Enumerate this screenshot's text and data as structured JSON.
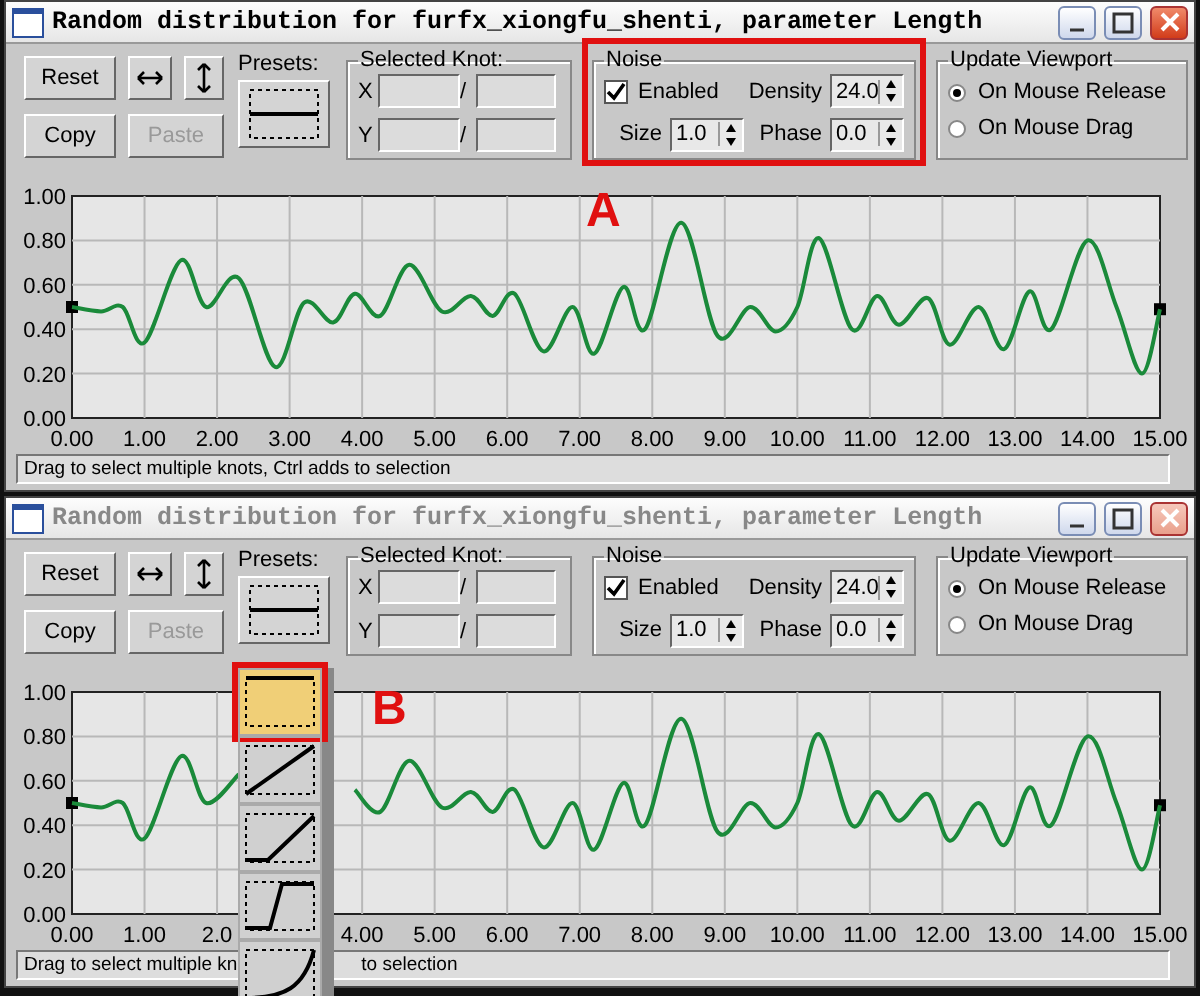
{
  "windows": [
    {
      "title": "Random distribution for furfx_xiongfu_shenti, parameter Length",
      "active": true,
      "toolbar": {
        "reset": "Reset",
        "copy": "Copy",
        "paste": {
          "label": "Paste",
          "disabled": true
        },
        "presets_label": "Presets:"
      },
      "selected_knot": {
        "title": "Selected Knot:",
        "rows": [
          {
            "label": "X",
            "separator": "/"
          },
          {
            "label": "Y",
            "separator": "/"
          }
        ]
      },
      "noise": {
        "title": "Noise",
        "enabled": {
          "label": "Enabled",
          "checked": true
        },
        "fields": [
          {
            "label": "Density",
            "value": "24.0"
          },
          {
            "label": "Size",
            "value": "1.0"
          },
          {
            "label": "Phase",
            "value": "0.0"
          }
        ],
        "annotation": {
          "label": "A"
        }
      },
      "update_viewport": {
        "title": "Update Viewport",
        "options": [
          {
            "label": "On Mouse Release",
            "selected": true
          },
          {
            "label": "On Mouse Drag",
            "selected": false
          }
        ]
      },
      "chart_data": {
        "type": "line",
        "xlim": [
          0,
          15
        ],
        "ylim": [
          0,
          1
        ],
        "yticks": [
          {
            "value": 1,
            "label": "1.00"
          },
          {
            "value": 0.8,
            "label": "0.80"
          },
          {
            "value": 0.6,
            "label": "0.60"
          },
          {
            "value": 0.4,
            "label": "0.40"
          },
          {
            "value": 0.2,
            "label": "0.20"
          },
          {
            "value": 0,
            "label": "0.00"
          }
        ],
        "xticks": [
          {
            "value": 0,
            "label": "0.00"
          },
          {
            "value": 1,
            "label": "1.00"
          },
          {
            "value": 2,
            "label": "2.00"
          },
          {
            "value": 3,
            "label": "3.00"
          },
          {
            "value": 4,
            "label": "4.00"
          },
          {
            "value": 5,
            "label": "5.00"
          },
          {
            "value": 6,
            "label": "6.00"
          },
          {
            "value": 7,
            "label": "7.00"
          },
          {
            "value": 8,
            "label": "8.00"
          },
          {
            "value": 9,
            "label": "9.00"
          },
          {
            "value": 10,
            "label": "10.00"
          },
          {
            "value": 11,
            "label": "11.00"
          },
          {
            "value": 12,
            "label": "12.00"
          },
          {
            "value": 13,
            "label": "13.00"
          },
          {
            "value": 14,
            "label": "14.00"
          },
          {
            "value": 15,
            "label": "15.00"
          }
        ],
        "x": [
          0,
          0.4,
          0.7,
          1,
          1.5,
          1.85,
          2.3,
          2.8,
          3.2,
          3.6,
          3.9,
          4.25,
          4.65,
          5.1,
          5.5,
          5.8,
          6.1,
          6.5,
          6.9,
          7.2,
          7.6,
          7.9,
          8.4,
          8.9,
          9.35,
          9.7,
          10,
          10.3,
          10.75,
          11.1,
          11.4,
          11.8,
          12.1,
          12.5,
          12.85,
          13.2,
          13.5,
          14,
          14.4,
          14.75,
          15
        ],
        "series": [
          {
            "color": "#1a8a3a",
            "values": [
              0.5,
              0.48,
              0.5,
              0.34,
              0.71,
              0.5,
              0.63,
              0.23,
              0.52,
              0.43,
              0.56,
              0.46,
              0.69,
              0.48,
              0.55,
              0.46,
              0.56,
              0.3,
              0.5,
              0.29,
              0.59,
              0.4,
              0.88,
              0.37,
              0.5,
              0.39,
              0.5,
              0.81,
              0.4,
              0.55,
              0.42,
              0.54,
              0.33,
              0.5,
              0.31,
              0.57,
              0.4,
              0.8,
              0.5,
              0.2,
              0.49
            ]
          }
        ],
        "grid": true
      },
      "status": [
        "Drag to select multiple knots, Ctrl adds to selection"
      ]
    },
    {
      "title": "Random distribution for furfx_xiongfu_shenti, parameter Length",
      "active": false,
      "toolbar": {
        "reset": "Reset",
        "copy": "Copy",
        "paste": {
          "label": "Paste",
          "disabled": true
        },
        "presets_label": "Presets:"
      },
      "selected_knot": {
        "title": "Selected Knot:",
        "rows": [
          {
            "label": "X",
            "separator": "/"
          },
          {
            "label": "Y",
            "separator": "/"
          }
        ]
      },
      "noise": {
        "title": "Noise",
        "enabled": {
          "label": "Enabled",
          "checked": true
        },
        "fields": [
          {
            "label": "Density",
            "value": "24.0"
          },
          {
            "label": "Size",
            "value": "1.0"
          },
          {
            "label": "Phase",
            "value": "0.0"
          }
        ]
      },
      "update_viewport": {
        "title": "Update Viewport",
        "options": [
          {
            "label": "On Mouse Release",
            "selected": true
          },
          {
            "label": "On Mouse Drag",
            "selected": false
          }
        ]
      },
      "chart_data": {
        "type": "line",
        "xlim": [
          0,
          15
        ],
        "ylim": [
          0,
          1
        ],
        "yticks": [
          {
            "value": 1,
            "label": "1.00"
          },
          {
            "value": 0.8,
            "label": "0.80"
          },
          {
            "value": 0.6,
            "label": "0.60"
          },
          {
            "value": 0.4,
            "label": "0.40"
          },
          {
            "value": 0.2,
            "label": "0.20"
          },
          {
            "value": 0,
            "label": "0.00"
          }
        ],
        "xticks": [
          {
            "value": 0,
            "label": "0.00"
          },
          {
            "value": 1,
            "label": "1.00"
          },
          {
            "value": 2,
            "label": "2.0"
          },
          {
            "value": 4,
            "label": "4.00"
          },
          {
            "value": 5,
            "label": "5.00"
          },
          {
            "value": 6,
            "label": "6.00"
          },
          {
            "value": 7,
            "label": "7.00"
          },
          {
            "value": 8,
            "label": "8.00"
          },
          {
            "value": 9,
            "label": "9.00"
          },
          {
            "value": 10,
            "label": "10.00"
          },
          {
            "value": 11,
            "label": "11.00"
          },
          {
            "value": 12,
            "label": "12.00"
          },
          {
            "value": 13,
            "label": "13.00"
          },
          {
            "value": 14,
            "label": "14.00"
          },
          {
            "value": 15,
            "label": "15.00"
          }
        ],
        "x": [
          0,
          0.4,
          0.7,
          1,
          1.5,
          1.85,
          2.3,
          2.8,
          3.2,
          3.6,
          3.9,
          4.25,
          4.65,
          5.1,
          5.5,
          5.8,
          6.1,
          6.5,
          6.9,
          7.2,
          7.6,
          7.9,
          8.4,
          8.9,
          9.35,
          9.7,
          10,
          10.3,
          10.75,
          11.1,
          11.4,
          11.8,
          12.1,
          12.5,
          12.85,
          13.2,
          13.5,
          14,
          14.4,
          14.75,
          15
        ],
        "series": [
          {
            "color": "#1a8a3a",
            "values": [
              0.5,
              0.48,
              0.5,
              0.34,
              0.71,
              0.5,
              0.63,
              null,
              null,
              null,
              0.56,
              0.46,
              0.69,
              0.48,
              0.55,
              0.46,
              0.56,
              0.3,
              0.5,
              0.29,
              0.59,
              0.4,
              0.88,
              0.37,
              0.5,
              0.39,
              0.5,
              0.81,
              0.4,
              0.55,
              0.42,
              0.54,
              0.33,
              0.5,
              0.31,
              0.57,
              0.4,
              0.8,
              0.5,
              0.2,
              0.49
            ]
          }
        ],
        "grid": true
      },
      "status": [
        "Drag to select multiple kn",
        "to selection"
      ],
      "preset_menu": {
        "expanded": true,
        "annotation": {
          "label": "B"
        },
        "items": [
          {
            "kind": "flat-top",
            "selected": true
          },
          {
            "kind": "linear",
            "selected": false
          },
          {
            "kind": "late-ramp",
            "selected": false
          },
          {
            "kind": "step",
            "selected": false
          },
          {
            "kind": "exponential",
            "selected": false
          }
        ]
      }
    }
  ]
}
